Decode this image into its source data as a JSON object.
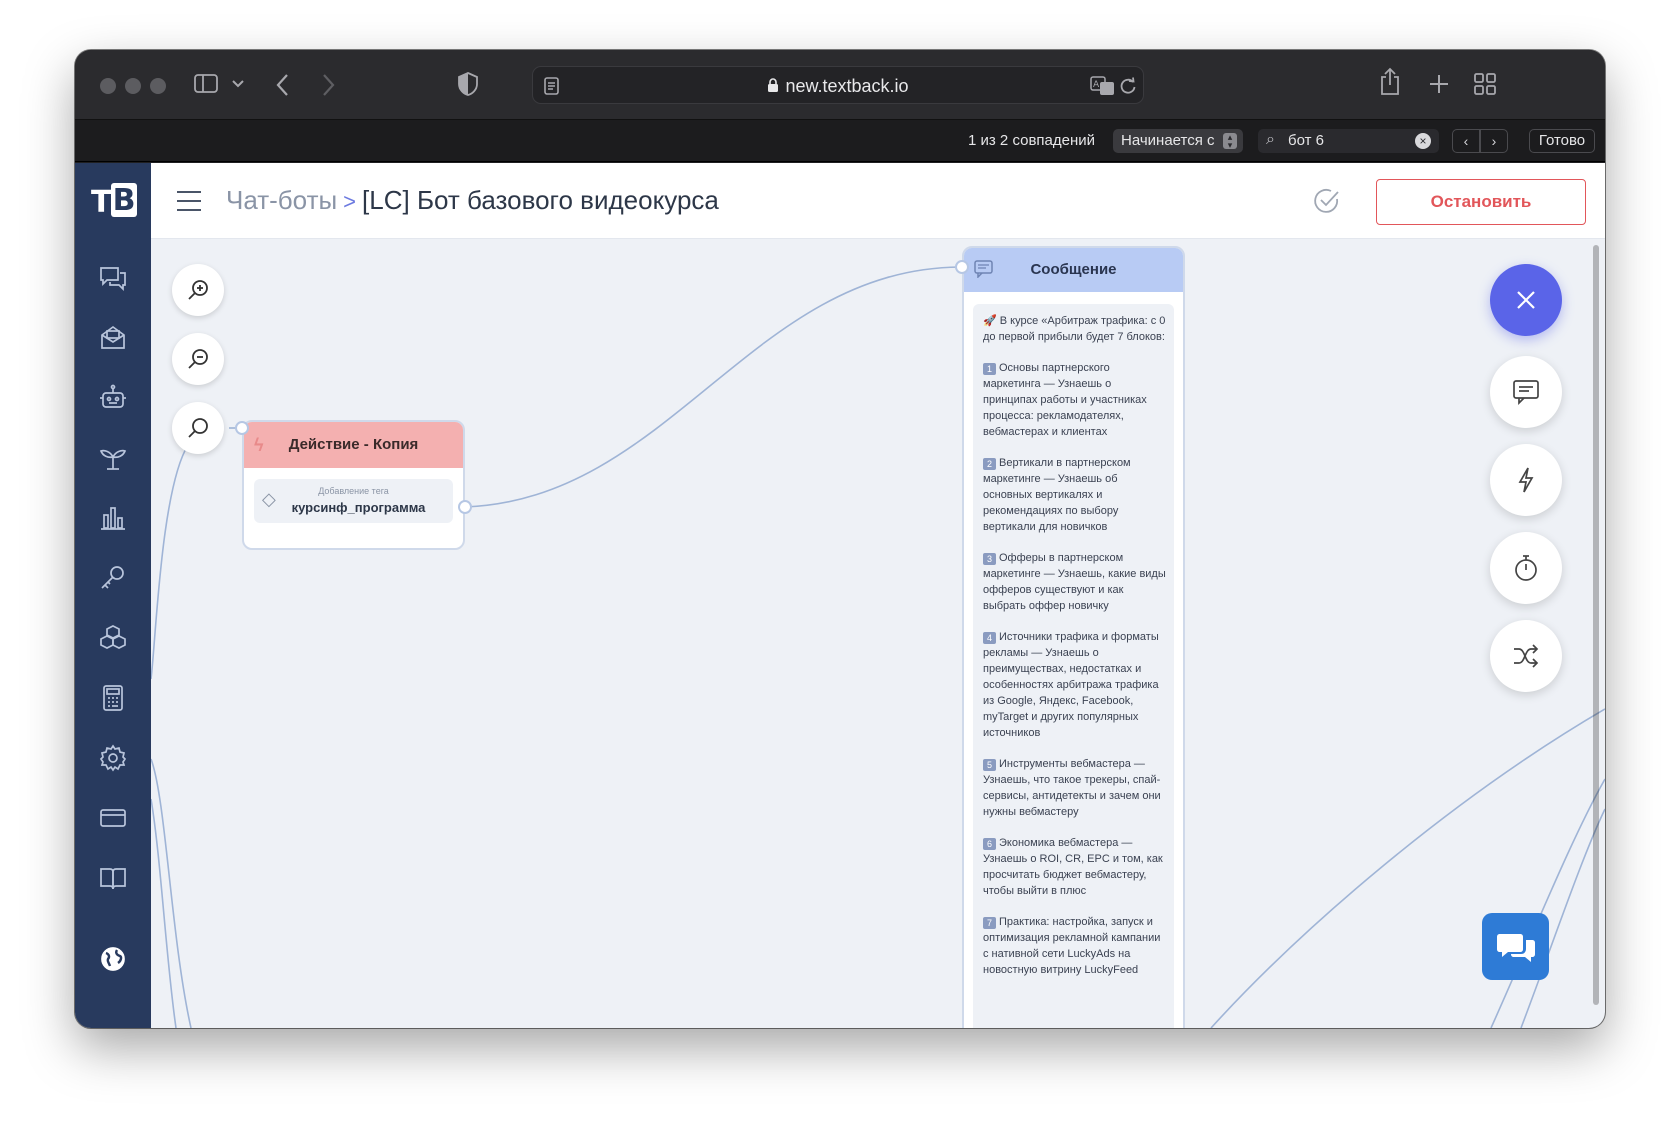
{
  "browser": {
    "url": "new.textback.io",
    "find": {
      "count_text": "1 из 2 совпадений",
      "mode": "Начинается с",
      "query": "бот 6",
      "done_label": "Готово"
    }
  },
  "header": {
    "breadcrumb_parent": "Чат-боты",
    "breadcrumb_separator": ">",
    "title": "[LC] Бот базового видеокурса",
    "stop_label": "Остановить"
  },
  "logo": {
    "t": "T",
    "b": "B"
  },
  "nodes": {
    "action": {
      "title": "Действие - Копия",
      "tag_label": "Добавление тега",
      "tag_value": "курсинф_программа"
    },
    "message": {
      "title": "Сообщение",
      "intro": "🚀 В курсе «Арбитраж трафика: с 0 до первой прибыли будет 7 блоков:",
      "blocks": [
        {
          "num": "1",
          "text": "Основы партнерского маркетинга — Узнаешь о принципах работы и участниках процесса: рекламодателях, вебмастерах и клиентах"
        },
        {
          "num": "2",
          "text": "Вертикали в партнерском маркетинге — Узнаешь об основных вертикалях и рекомендациях по выбору вертикали для новичков"
        },
        {
          "num": "3",
          "text": "Офферы в партнерском маркетинге — Узнаешь, какие виды офферов существуют и как выбрать оффер новичку"
        },
        {
          "num": "4",
          "text": "Источники трафика и форматы рекламы — Узнаешь о преимуществах, недостатках и особенностях арбитража трафика из Google, Яндекс, Facebook, myTarget и других популярных источников"
        },
        {
          "num": "5",
          "text": "Инструменты вебмастера — Узнаешь, что такое трекеры, спай-сервисы, антидетекты и зачем они нужны вебмастеру"
        },
        {
          "num": "6",
          "text": "Экономика вебмастера — Узнаешь о ROI, CR, EPC и том, как просчитать бюджет вебмастеру, чтобы выйти в плюс"
        },
        {
          "num": "7",
          "text": "Практика: настройка, запуск и оптимизация рекламной кампании с нативной сети LuckyAds на новостную витрину LuckyFeed"
        }
      ]
    }
  },
  "colors": {
    "sidebar": "#283a5e",
    "accent": "#5a64e8",
    "stop": "#e2565a",
    "action_header": "#f4b0b0",
    "message_header": "#b8cbf4",
    "chat_widget": "#2e7bd6"
  }
}
